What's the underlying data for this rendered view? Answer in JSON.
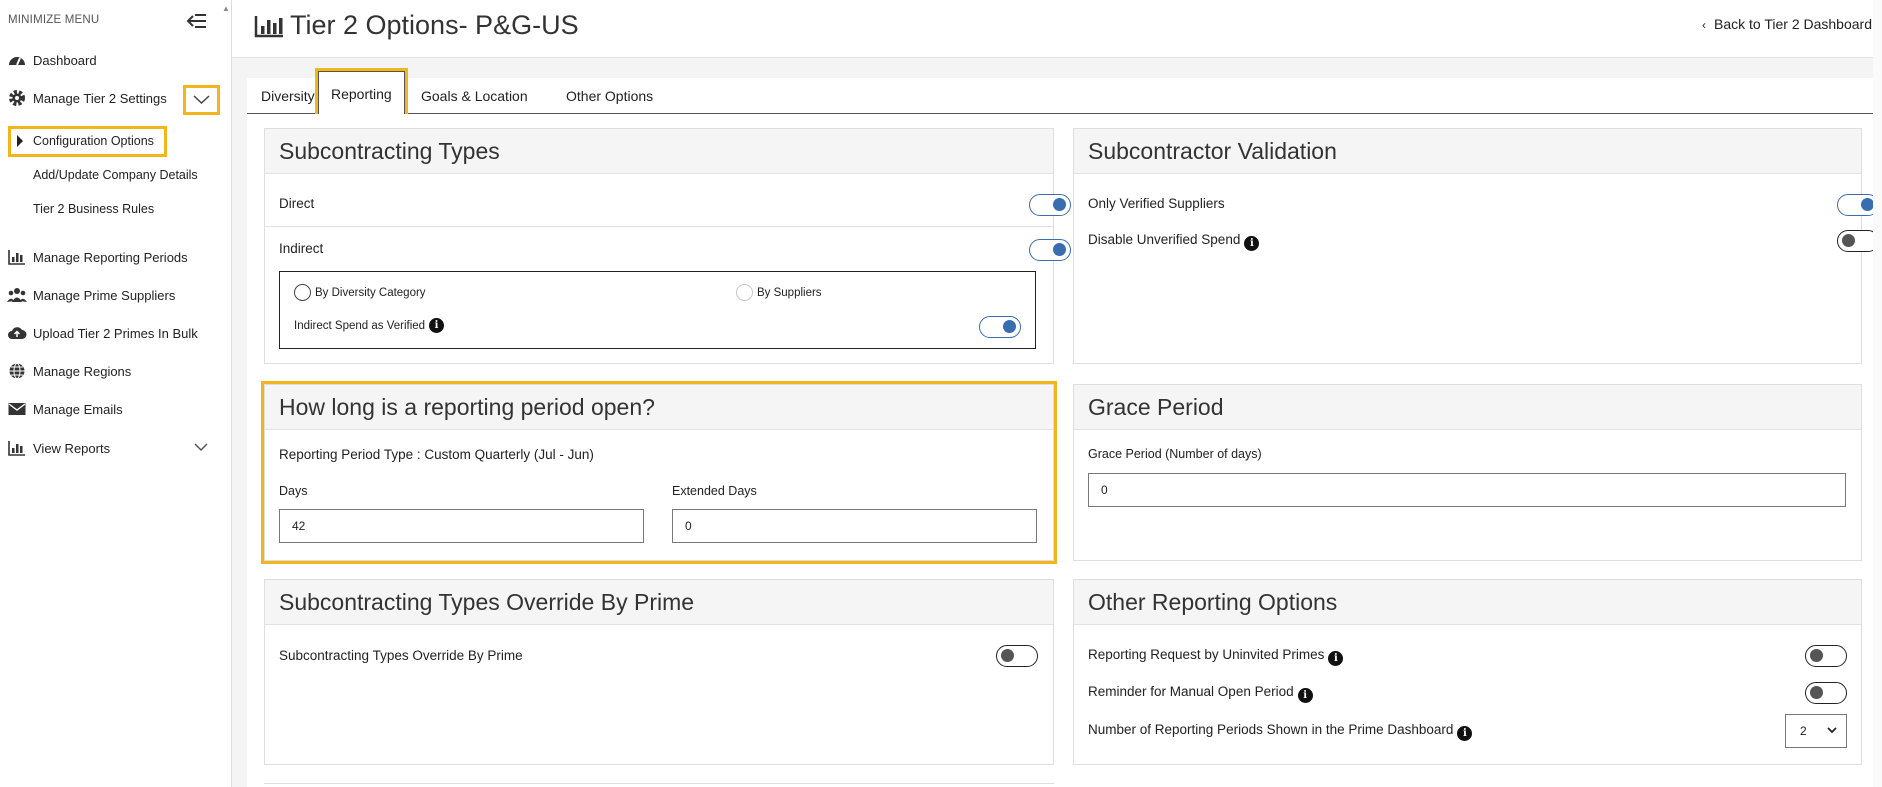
{
  "sidebar": {
    "minimize_label": "MINIMIZE MENU",
    "items": [
      {
        "label": "Dashboard",
        "icon": "speedometer-icon"
      },
      {
        "label": "Manage Tier 2 Settings",
        "icon": "gear-icon"
      },
      {
        "label": "Manage Reporting Periods",
        "icon": "bar-chart-icon"
      },
      {
        "label": "Manage Prime Suppliers",
        "icon": "users-icon"
      },
      {
        "label": "Upload Tier 2 Primes In Bulk",
        "icon": "cloud-upload-icon"
      },
      {
        "label": "Manage Regions",
        "icon": "globe-icon"
      },
      {
        "label": "Manage Emails",
        "icon": "envelope-icon"
      },
      {
        "label": "View Reports",
        "icon": "bar-chart-icon"
      }
    ],
    "subitems": [
      {
        "label": "Configuration Options"
      },
      {
        "label": "Add/Update Company Details"
      },
      {
        "label": "Tier 2 Business Rules"
      }
    ]
  },
  "header": {
    "title": "Tier 2 Options- P&G-US",
    "back_label": "Back to Tier 2 Dashboard"
  },
  "tabs": [
    {
      "label": "Diversity"
    },
    {
      "label": "Reporting"
    },
    {
      "label": "Goals & Location"
    },
    {
      "label": "Other Options"
    }
  ],
  "subcontracting_types": {
    "title": "Subcontracting Types",
    "direct_label": "Direct",
    "direct_on": true,
    "indirect_label": "Indirect",
    "indirect_on": true,
    "radio_diversity": "By Diversity Category",
    "radio_suppliers": "By Suppliers",
    "indirect_verified_label": "Indirect Spend as Verified",
    "indirect_verified_on": true
  },
  "validation": {
    "title": "Subcontractor Validation",
    "only_verified_label": "Only Verified Suppliers",
    "only_verified_on": true,
    "disable_unverified_label": "Disable Unverified Spend",
    "disable_unverified_on": false
  },
  "reporting_period": {
    "title": "How long is a reporting period open?",
    "type_text": "Reporting Period Type : Custom Quarterly (Jul - Jun)",
    "days_label": "Days",
    "days_value": "42",
    "extended_label": "Extended Days",
    "extended_value": "0"
  },
  "grace": {
    "title": "Grace Period",
    "label": "Grace Period (Number of days)",
    "value": "0"
  },
  "override": {
    "title": "Subcontracting Types Override By Prime",
    "label": "Subcontracting Types Override By Prime",
    "on": false
  },
  "other_reporting": {
    "title": "Other Reporting Options",
    "uninvited_label": "Reporting Request by Uninvited Primes",
    "uninvited_on": false,
    "reminder_label": "Reminder for Manual Open Period",
    "reminder_on": false,
    "periods_label": "Number of Reporting Periods Shown in the Prime Dashboard",
    "periods_value": "2"
  },
  "colors": {
    "accent": "#3a6cb0",
    "highlight": "#f2b51c"
  }
}
